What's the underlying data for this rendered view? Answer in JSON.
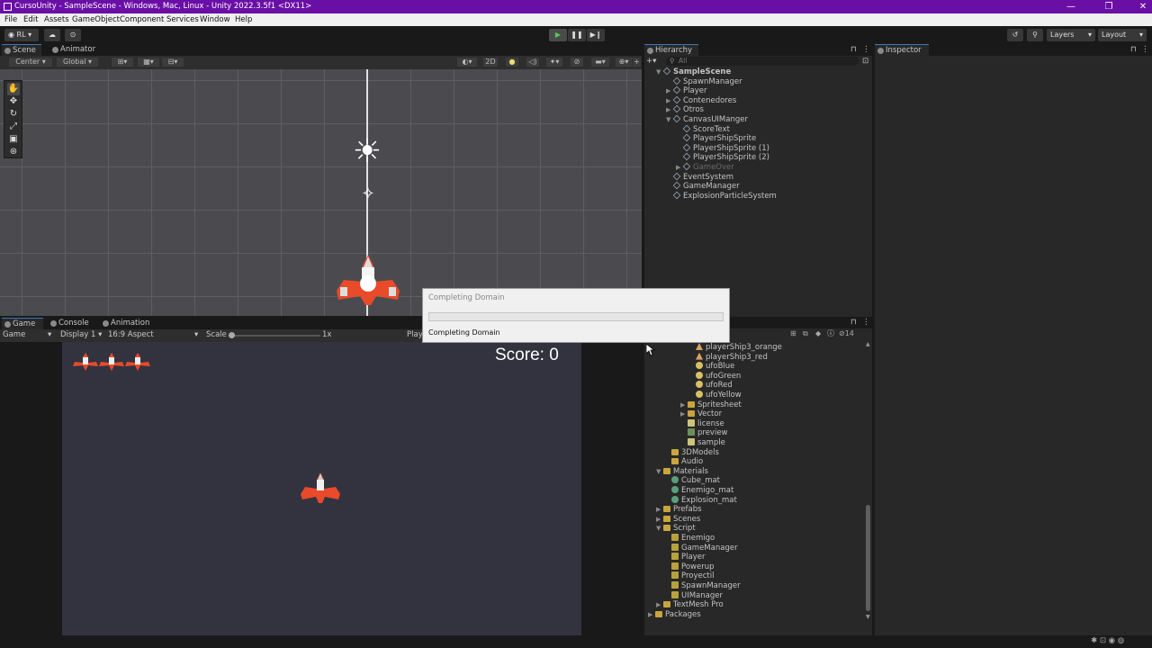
{
  "window": {
    "title": "CursoUnity - SampleScene - Windows, Mac, Linux - Unity 2022.3.5f1 <DX11>",
    "minimize": "—",
    "maximize": "❐",
    "close": "✕"
  },
  "menu": [
    "File",
    "Edit",
    "Assets",
    "GameObject",
    "Component",
    "Services",
    "Window",
    "Help"
  ],
  "toolbar": {
    "account": "RL",
    "layers": "Layers",
    "layout": "Layout"
  },
  "scene_tabs": [
    "Scene",
    "Animator"
  ],
  "scene_toolbar": {
    "pivot": "Center",
    "space": "Global",
    "mode2d": "2D"
  },
  "game_tabs": [
    "Game",
    "Console",
    "Animation"
  ],
  "game_toolbar": {
    "view": "Game",
    "display": "Display 1",
    "aspect": "16:9 Aspect",
    "scale_label": "Scale",
    "scale_value": "1x",
    "play_partial": "Play"
  },
  "game": {
    "score": "Score: 0"
  },
  "hierarchy": {
    "tab": "Hierarchy",
    "search_placeholder": "All",
    "scene": "SampleScene",
    "items": [
      {
        "label": "SpawnManager",
        "depth": 1,
        "expand": false
      },
      {
        "label": "Player",
        "depth": 1,
        "expand": true
      },
      {
        "label": "Contenedores",
        "depth": 1,
        "expand": true
      },
      {
        "label": "Otros",
        "depth": 1,
        "expand": true
      },
      {
        "label": "CanvasUIManger",
        "depth": 1,
        "expand": true
      },
      {
        "label": "ScoreText",
        "depth": 2,
        "expand": false
      },
      {
        "label": "PlayerShipSprite",
        "depth": 2,
        "expand": false
      },
      {
        "label": "PlayerShipSprite (1)",
        "depth": 2,
        "expand": false
      },
      {
        "label": "PlayerShipSprite (2)",
        "depth": 2,
        "expand": false
      },
      {
        "label": "GameOver",
        "depth": 2,
        "expand": true,
        "disabled": true
      },
      {
        "label": "EventSystem",
        "depth": 1,
        "expand": false
      },
      {
        "label": "GameManager",
        "depth": 1,
        "expand": false
      },
      {
        "label": "ExplosionParticleSystem",
        "depth": 1,
        "expand": false
      }
    ]
  },
  "inspector": {
    "tab": "Inspector"
  },
  "project": {
    "hidden_count": "14",
    "items": [
      {
        "label": "playerShip3_orange",
        "depth": 5,
        "icon": "sprite"
      },
      {
        "label": "playerShip3_red",
        "depth": 5,
        "icon": "sprite"
      },
      {
        "label": "ufoBlue",
        "depth": 5,
        "icon": "ufo"
      },
      {
        "label": "ufoGreen",
        "depth": 5,
        "icon": "ufo"
      },
      {
        "label": "ufoRed",
        "depth": 5,
        "icon": "ufo"
      },
      {
        "label": "ufoYellow",
        "depth": 5,
        "icon": "ufo"
      },
      {
        "label": "Spritesheet",
        "depth": 4,
        "icon": "folder",
        "expand": true
      },
      {
        "label": "Vector",
        "depth": 4,
        "icon": "folder",
        "expand": true
      },
      {
        "label": "license",
        "depth": 4,
        "icon": "doc"
      },
      {
        "label": "preview",
        "depth": 4,
        "icon": "image"
      },
      {
        "label": "sample",
        "depth": 4,
        "icon": "doc"
      },
      {
        "label": "3DModels",
        "depth": 2,
        "icon": "folder"
      },
      {
        "label": "Audio",
        "depth": 2,
        "icon": "folder"
      },
      {
        "label": "Materials",
        "depth": 1,
        "icon": "folder",
        "open": true
      },
      {
        "label": "Cube_mat",
        "depth": 2,
        "icon": "mat"
      },
      {
        "label": "Enemigo_mat",
        "depth": 2,
        "icon": "mat"
      },
      {
        "label": "Explosion_mat",
        "depth": 2,
        "icon": "mat"
      },
      {
        "label": "Prefabs",
        "depth": 1,
        "icon": "folder",
        "expand": true
      },
      {
        "label": "Scenes",
        "depth": 1,
        "icon": "folder",
        "expand": true
      },
      {
        "label": "Script",
        "depth": 1,
        "icon": "folder",
        "open": true
      },
      {
        "label": "Enemigo",
        "depth": 2,
        "icon": "script"
      },
      {
        "label": "GameManager",
        "depth": 2,
        "icon": "script"
      },
      {
        "label": "Player",
        "depth": 2,
        "icon": "script"
      },
      {
        "label": "Powerup",
        "depth": 2,
        "icon": "script"
      },
      {
        "label": "Proyectil",
        "depth": 2,
        "icon": "script"
      },
      {
        "label": "SpawnManager",
        "depth": 2,
        "icon": "script"
      },
      {
        "label": "UIManager",
        "depth": 2,
        "icon": "script"
      },
      {
        "label": "TextMesh Pro",
        "depth": 1,
        "icon": "folder",
        "expand": true
      },
      {
        "label": "Packages",
        "depth": 0,
        "icon": "folder",
        "expand": true
      }
    ]
  },
  "dialog": {
    "title": "Completing Domain",
    "message": "Completing Domain",
    "progress": 0.0
  },
  "colors": {
    "titlebar": "#6a0fa6",
    "accent": "#3a79bb"
  }
}
